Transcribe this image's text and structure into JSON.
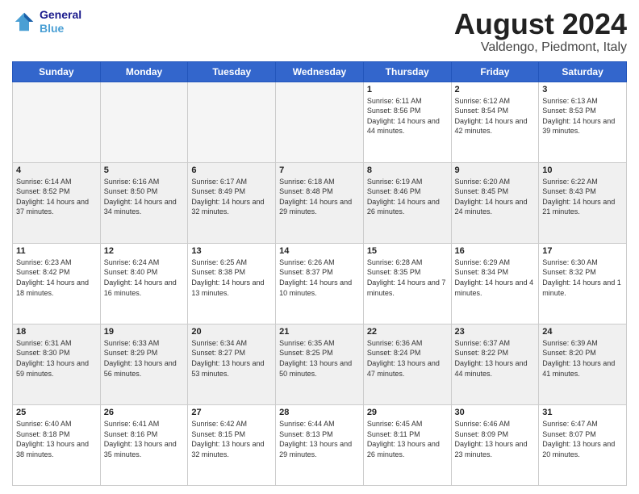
{
  "header": {
    "logo_line1": "General",
    "logo_line2": "Blue",
    "title": "August 2024",
    "location": "Valdengo, Piedmont, Italy"
  },
  "days_of_week": [
    "Sunday",
    "Monday",
    "Tuesday",
    "Wednesday",
    "Thursday",
    "Friday",
    "Saturday"
  ],
  "weeks": [
    [
      {
        "day": "",
        "info": "",
        "empty": true
      },
      {
        "day": "",
        "info": "",
        "empty": true
      },
      {
        "day": "",
        "info": "",
        "empty": true
      },
      {
        "day": "",
        "info": "",
        "empty": true
      },
      {
        "day": "1",
        "info": "Sunrise: 6:11 AM\nSunset: 8:56 PM\nDaylight: 14 hours and 44 minutes.",
        "empty": false
      },
      {
        "day": "2",
        "info": "Sunrise: 6:12 AM\nSunset: 8:54 PM\nDaylight: 14 hours and 42 minutes.",
        "empty": false
      },
      {
        "day": "3",
        "info": "Sunrise: 6:13 AM\nSunset: 8:53 PM\nDaylight: 14 hours and 39 minutes.",
        "empty": false
      }
    ],
    [
      {
        "day": "4",
        "info": "Sunrise: 6:14 AM\nSunset: 8:52 PM\nDaylight: 14 hours and 37 minutes.",
        "empty": false,
        "shaded": true
      },
      {
        "day": "5",
        "info": "Sunrise: 6:16 AM\nSunset: 8:50 PM\nDaylight: 14 hours and 34 minutes.",
        "empty": false,
        "shaded": true
      },
      {
        "day": "6",
        "info": "Sunrise: 6:17 AM\nSunset: 8:49 PM\nDaylight: 14 hours and 32 minutes.",
        "empty": false,
        "shaded": true
      },
      {
        "day": "7",
        "info": "Sunrise: 6:18 AM\nSunset: 8:48 PM\nDaylight: 14 hours and 29 minutes.",
        "empty": false,
        "shaded": true
      },
      {
        "day": "8",
        "info": "Sunrise: 6:19 AM\nSunset: 8:46 PM\nDaylight: 14 hours and 26 minutes.",
        "empty": false,
        "shaded": true
      },
      {
        "day": "9",
        "info": "Sunrise: 6:20 AM\nSunset: 8:45 PM\nDaylight: 14 hours and 24 minutes.",
        "empty": false,
        "shaded": true
      },
      {
        "day": "10",
        "info": "Sunrise: 6:22 AM\nSunset: 8:43 PM\nDaylight: 14 hours and 21 minutes.",
        "empty": false,
        "shaded": true
      }
    ],
    [
      {
        "day": "11",
        "info": "Sunrise: 6:23 AM\nSunset: 8:42 PM\nDaylight: 14 hours and 18 minutes.",
        "empty": false
      },
      {
        "day": "12",
        "info": "Sunrise: 6:24 AM\nSunset: 8:40 PM\nDaylight: 14 hours and 16 minutes.",
        "empty": false
      },
      {
        "day": "13",
        "info": "Sunrise: 6:25 AM\nSunset: 8:38 PM\nDaylight: 14 hours and 13 minutes.",
        "empty": false
      },
      {
        "day": "14",
        "info": "Sunrise: 6:26 AM\nSunset: 8:37 PM\nDaylight: 14 hours and 10 minutes.",
        "empty": false
      },
      {
        "day": "15",
        "info": "Sunrise: 6:28 AM\nSunset: 8:35 PM\nDaylight: 14 hours and 7 minutes.",
        "empty": false
      },
      {
        "day": "16",
        "info": "Sunrise: 6:29 AM\nSunset: 8:34 PM\nDaylight: 14 hours and 4 minutes.",
        "empty": false
      },
      {
        "day": "17",
        "info": "Sunrise: 6:30 AM\nSunset: 8:32 PM\nDaylight: 14 hours and 1 minute.",
        "empty": false
      }
    ],
    [
      {
        "day": "18",
        "info": "Sunrise: 6:31 AM\nSunset: 8:30 PM\nDaylight: 13 hours and 59 minutes.",
        "empty": false,
        "shaded": true
      },
      {
        "day": "19",
        "info": "Sunrise: 6:33 AM\nSunset: 8:29 PM\nDaylight: 13 hours and 56 minutes.",
        "empty": false,
        "shaded": true
      },
      {
        "day": "20",
        "info": "Sunrise: 6:34 AM\nSunset: 8:27 PM\nDaylight: 13 hours and 53 minutes.",
        "empty": false,
        "shaded": true
      },
      {
        "day": "21",
        "info": "Sunrise: 6:35 AM\nSunset: 8:25 PM\nDaylight: 13 hours and 50 minutes.",
        "empty": false,
        "shaded": true
      },
      {
        "day": "22",
        "info": "Sunrise: 6:36 AM\nSunset: 8:24 PM\nDaylight: 13 hours and 47 minutes.",
        "empty": false,
        "shaded": true
      },
      {
        "day": "23",
        "info": "Sunrise: 6:37 AM\nSunset: 8:22 PM\nDaylight: 13 hours and 44 minutes.",
        "empty": false,
        "shaded": true
      },
      {
        "day": "24",
        "info": "Sunrise: 6:39 AM\nSunset: 8:20 PM\nDaylight: 13 hours and 41 minutes.",
        "empty": false,
        "shaded": true
      }
    ],
    [
      {
        "day": "25",
        "info": "Sunrise: 6:40 AM\nSunset: 8:18 PM\nDaylight: 13 hours and 38 minutes.",
        "empty": false
      },
      {
        "day": "26",
        "info": "Sunrise: 6:41 AM\nSunset: 8:16 PM\nDaylight: 13 hours and 35 minutes.",
        "empty": false
      },
      {
        "day": "27",
        "info": "Sunrise: 6:42 AM\nSunset: 8:15 PM\nDaylight: 13 hours and 32 minutes.",
        "empty": false
      },
      {
        "day": "28",
        "info": "Sunrise: 6:44 AM\nSunset: 8:13 PM\nDaylight: 13 hours and 29 minutes.",
        "empty": false
      },
      {
        "day": "29",
        "info": "Sunrise: 6:45 AM\nSunset: 8:11 PM\nDaylight: 13 hours and 26 minutes.",
        "empty": false
      },
      {
        "day": "30",
        "info": "Sunrise: 6:46 AM\nSunset: 8:09 PM\nDaylight: 13 hours and 23 minutes.",
        "empty": false
      },
      {
        "day": "31",
        "info": "Sunrise: 6:47 AM\nSunset: 8:07 PM\nDaylight: 13 hours and 20 minutes.",
        "empty": false
      }
    ]
  ]
}
